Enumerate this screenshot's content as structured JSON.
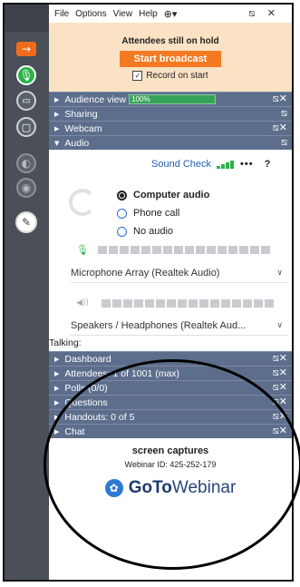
{
  "menu": [
    "File",
    "Options",
    "View",
    "Help"
  ],
  "menu_icons": {
    "globe": "globe-icon",
    "window_controls": "minimize-close-icons"
  },
  "window_ctrls": "⧅ ✕",
  "hold": {
    "title": "Attendees still on hold",
    "start_button": "Start broadcast",
    "record_label": "Record on start",
    "record_checked": true
  },
  "sections_top": [
    {
      "label": "Audience view",
      "meter": "100%"
    },
    {
      "label": "Sharing"
    },
    {
      "label": "Webcam"
    },
    {
      "label": "Audio"
    }
  ],
  "audio": {
    "sound_check": "Sound Check",
    "more": "•••",
    "help": "?",
    "options": [
      "Computer audio",
      "Phone call",
      "No audio"
    ],
    "selected_option": "Computer audio",
    "mic_device": "Microphone Array (Realtek Audio)",
    "speaker_device": "Speakers / Headphones (Realtek Aud...",
    "talking_label": "Talking:"
  },
  "sections_bottom": [
    {
      "label": "Dashboard"
    },
    {
      "label": "Attendees:  1 of 1001 (max)"
    },
    {
      "label": "Polls (0/0)"
    },
    {
      "label": "Questions"
    },
    {
      "label": "Handouts: 0 of 5"
    },
    {
      "label": "Chat"
    }
  ],
  "footer": {
    "session_name": "screen captures",
    "webinar_id": "Webinar ID: 425-252-179",
    "brand_bold": "GoTo",
    "brand_light": "Webinar"
  },
  "colors": {
    "rail": "#4a4f58",
    "section_header": "#5d6e8c",
    "hold_bg": "#fbe2c4",
    "broadcast_button": "#f47a22",
    "accent_green": "#2bb24c",
    "link_blue": "#1f5fb5"
  }
}
